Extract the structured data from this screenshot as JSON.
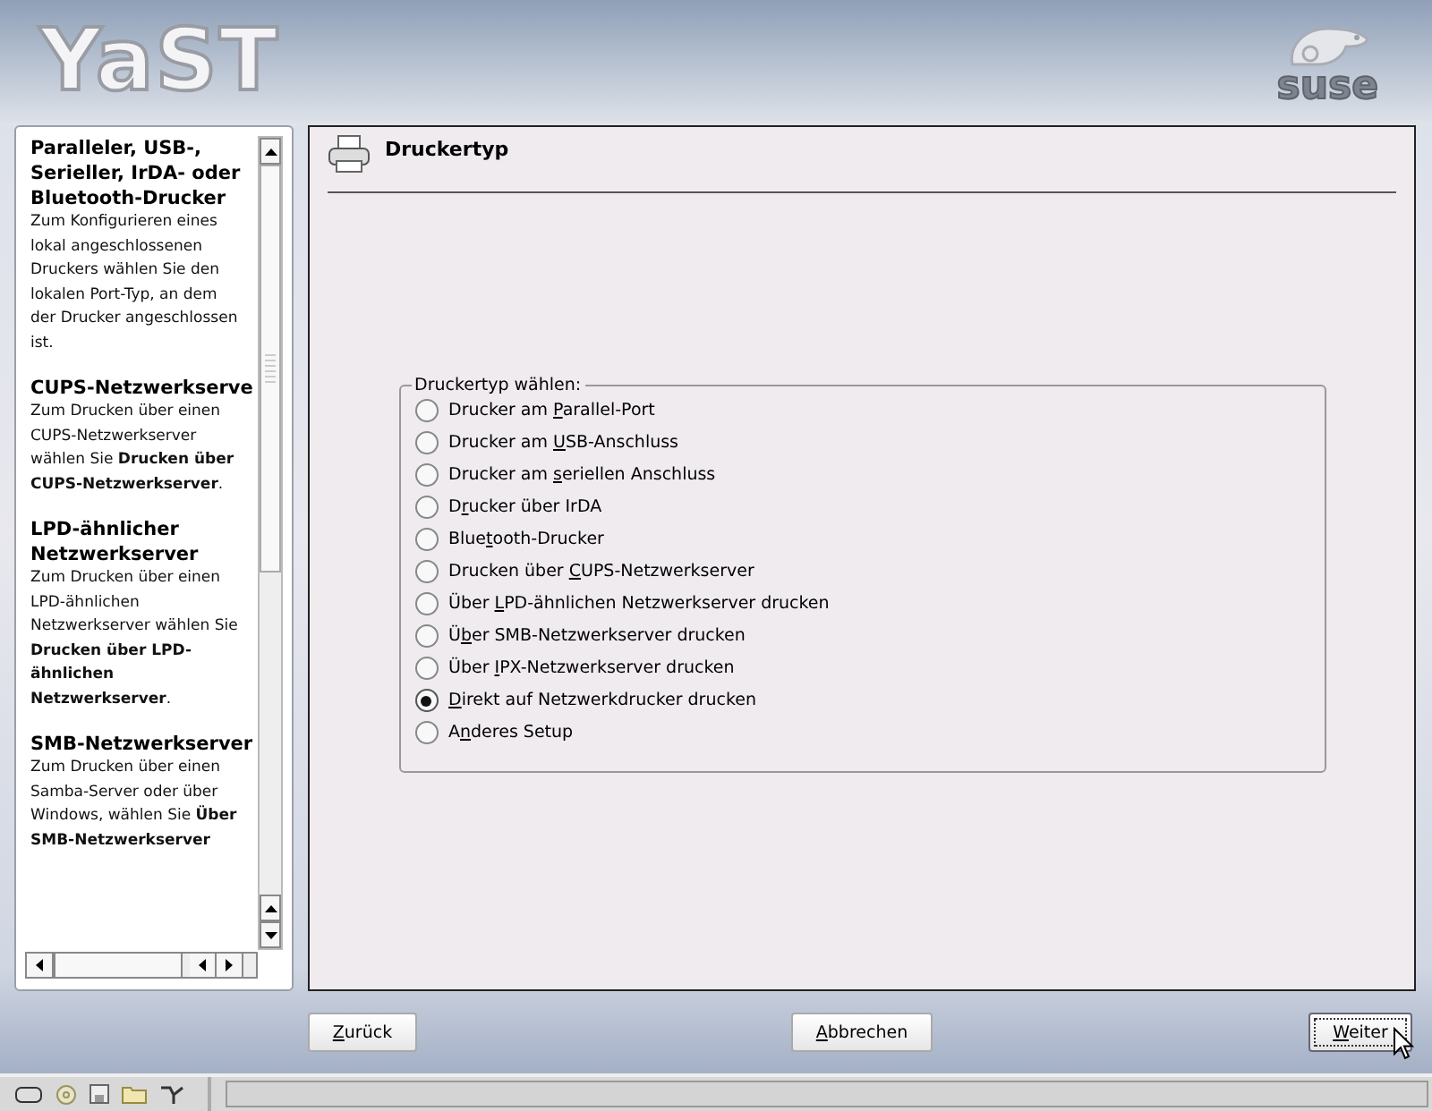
{
  "header": {
    "logo": "YaST",
    "brand": "suse"
  },
  "help": {
    "sections": [
      {
        "heading": "Paralleler, USB-, Serieller, IrDA- oder Bluetooth-Drucker",
        "text": "Zum Konfigurieren eines lokal angeschlossenen Druckers wählen Sie den lokalen Port-Typ, an dem der Drucker angeschlossen ist."
      },
      {
        "heading": "CUPS-Netzwerkserve",
        "text": "Zum Drucken über einen CUPS-Netzwerkserver wählen Sie **Drucken über CUPS-Netzwerkserver**."
      },
      {
        "heading": "LPD-ähnlicher Netzwerkserver",
        "text": "Zum Drucken über einen LPD-ähnlichen Netzwerkserver wählen Sie **Drucken über LPD-ähnlichen Netzwerkserver**."
      },
      {
        "heading": "SMB-Netzwerkserver",
        "text": "Zum Drucken über einen Samba-Server oder über Windows, wählen Sie **Über SMB-Netzwerkserver**"
      }
    ]
  },
  "page": {
    "title": "Druckertyp",
    "group_label": "Druckertyp wählen:",
    "options": [
      {
        "label": [
          "Drucker am ",
          "P",
          "arallel-Port"
        ],
        "selected": false
      },
      {
        "label": [
          "Drucker am ",
          "U",
          "SB-Anschluss"
        ],
        "selected": false
      },
      {
        "label": [
          "Drucker am ",
          "s",
          "eriellen Anschluss"
        ],
        "selected": false
      },
      {
        "label": [
          "D",
          "r",
          "ucker über IrDA"
        ],
        "selected": false
      },
      {
        "label": [
          "Blue",
          "t",
          "ooth-Drucker"
        ],
        "selected": false
      },
      {
        "label": [
          "Drucken über ",
          "C",
          "UPS-Netzwerkserver"
        ],
        "selected": false
      },
      {
        "label": [
          "Über ",
          "L",
          "PD-ähnlichen Netzwerkserver drucken"
        ],
        "selected": false
      },
      {
        "label": [
          "Ü",
          "b",
          "er SMB-Netzwerkserver drucken"
        ],
        "selected": false
      },
      {
        "label": [
          "Über ",
          "I",
          "PX-Netzwerkserver drucken"
        ],
        "selected": false
      },
      {
        "label": [
          "D",
          "irekt auf Netzwerkdrucker drucken"
        ],
        "selected": true
      },
      {
        "label": [
          "A",
          "n",
          "deres Setup"
        ],
        "selected": false
      }
    ]
  },
  "buttons": [
    {
      "label": [
        "Z",
        "urück"
      ],
      "focused": false
    },
    {
      "label": [
        "A",
        "bbrechen"
      ],
      "focused": false
    },
    {
      "label": [
        "W",
        "eiter"
      ],
      "focused": true
    }
  ]
}
